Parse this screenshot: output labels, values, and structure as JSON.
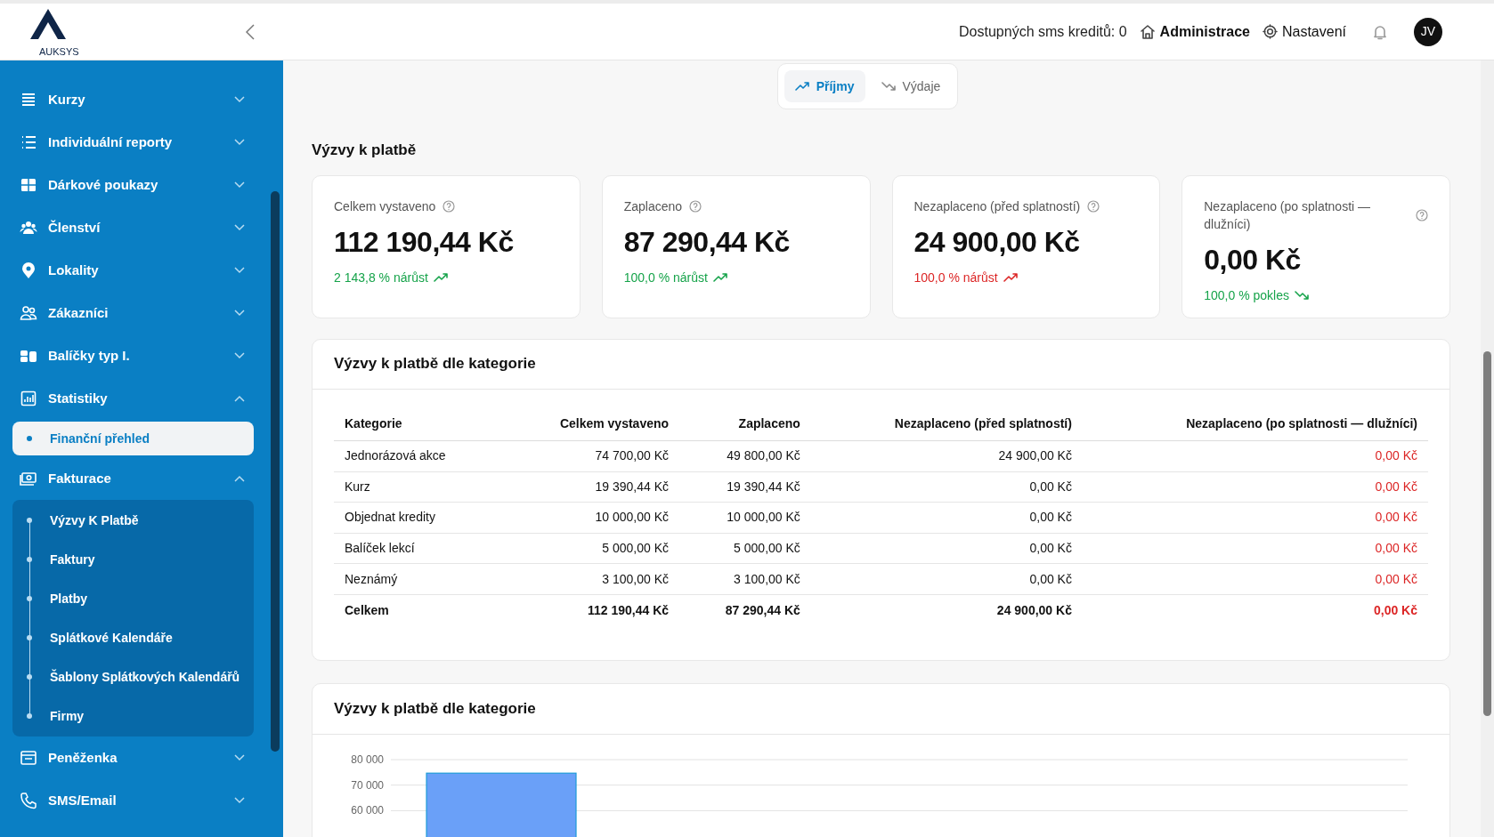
{
  "header": {
    "logo": "AUKSYS",
    "sms_credits": "Dostupných sms kreditů: 0",
    "links": [
      {
        "label": "Administrace",
        "kind": "admin"
      },
      {
        "label": "Nastavení",
        "kind": "settings"
      }
    ],
    "avatar": "JV"
  },
  "sidebar": {
    "items": [
      {
        "label": "Kurzy",
        "expanded": false
      },
      {
        "label": "Individuální reporty",
        "expanded": false
      },
      {
        "label": "Dárkové poukazy",
        "expanded": false
      },
      {
        "label": "Členství",
        "expanded": false
      },
      {
        "label": "Lokality",
        "expanded": false
      },
      {
        "label": "Zákazníci",
        "expanded": false
      },
      {
        "label": "Balíčky typ I.",
        "expanded": false
      },
      {
        "label": "Statistiky",
        "expanded": true,
        "children": [
          {
            "label": "Finanční přehled",
            "selected": true
          }
        ]
      },
      {
        "label": "Fakturace",
        "expanded": true,
        "children": [
          {
            "label": "Výzvy K Platbě",
            "selected": false
          },
          {
            "label": "Faktury",
            "selected": false
          },
          {
            "label": "Platby",
            "selected": false
          },
          {
            "label": "Splátkové Kalendáře",
            "selected": false
          },
          {
            "label": "Šablony Splátkových Kalendářů",
            "selected": false
          },
          {
            "label": "Firmy",
            "selected": false
          }
        ]
      },
      {
        "label": "Peněženka",
        "expanded": false
      },
      {
        "label": "SMS/Email",
        "expanded": false
      }
    ]
  },
  "tabs": [
    {
      "label": "Příjmy",
      "selected": true,
      "kind": "up"
    },
    {
      "label": "Výdaje",
      "selected": false,
      "kind": "down"
    }
  ],
  "section_title": "Výzvy k platbě",
  "cards": [
    {
      "label": "Celkem vystaveno",
      "value": "112 190,44 Kč",
      "change": "2 143,8 % nárůst",
      "kind": "up",
      "color": "#16a34a"
    },
    {
      "label": "Zaplaceno",
      "value": "87 290,44 Kč",
      "change": "100,0 % nárůst",
      "kind": "up",
      "color": "#16a34a"
    },
    {
      "label": "Nezaplaceno (před splatností)",
      "value": "24 900,00 Kč",
      "change": "100,0 % nárůst",
      "kind": "up",
      "color": "#dc2626"
    },
    {
      "label": "Nezaplaceno (po splatnosti — dlužníci)",
      "value": "0,00 Kč",
      "change": "100,0 % pokles",
      "kind": "down",
      "color": "#16a34a"
    }
  ],
  "table": {
    "title": "Výzvy k platbě dle kategorie",
    "columns": [
      "Kategorie",
      "Celkem vystaveno",
      "Zaplaceno",
      "Nezaplaceno (před splatností)",
      "Nezaplaceno (po splatnosti — dlužníci)"
    ],
    "rows": [
      [
        "Jednorázová akce",
        "74 700,00 Kč",
        "49 800,00 Kč",
        "24 900,00 Kč",
        "0,00 Kč"
      ],
      [
        "Kurz",
        "19 390,44 Kč",
        "19 390,44 Kč",
        "0,00 Kč",
        "0,00 Kč"
      ],
      [
        "Objednat kredity",
        "10 000,00 Kč",
        "10 000,00 Kč",
        "0,00 Kč",
        "0,00 Kč"
      ],
      [
        "Balíček lekcí",
        "5 000,00 Kč",
        "5 000,00 Kč",
        "0,00 Kč",
        "0,00 Kč"
      ],
      [
        "Neznámý",
        "3 100,00 Kč",
        "3 100,00 Kč",
        "0,00 Kč",
        "0,00 Kč"
      ]
    ],
    "total": [
      "Celkem",
      "112 190,44 Kč",
      "87 290,44 Kč",
      "24 900,00 Kč",
      "0,00 Kč"
    ]
  },
  "chart": {
    "title": "Výzvy k platbě dle kategorie",
    "chart_data": {
      "type": "bar",
      "grid": true,
      "ylim": [
        0,
        80000
      ],
      "series": [
        {
          "color": "#6aa0f8",
          "values": [
            74700
          ]
        }
      ],
      "yticks": [
        {
          "value": 60000,
          "label": "60 000"
        },
        {
          "value": 70000,
          "label": "70 000"
        },
        {
          "value": 80000,
          "label": "80 000"
        }
      ]
    }
  }
}
